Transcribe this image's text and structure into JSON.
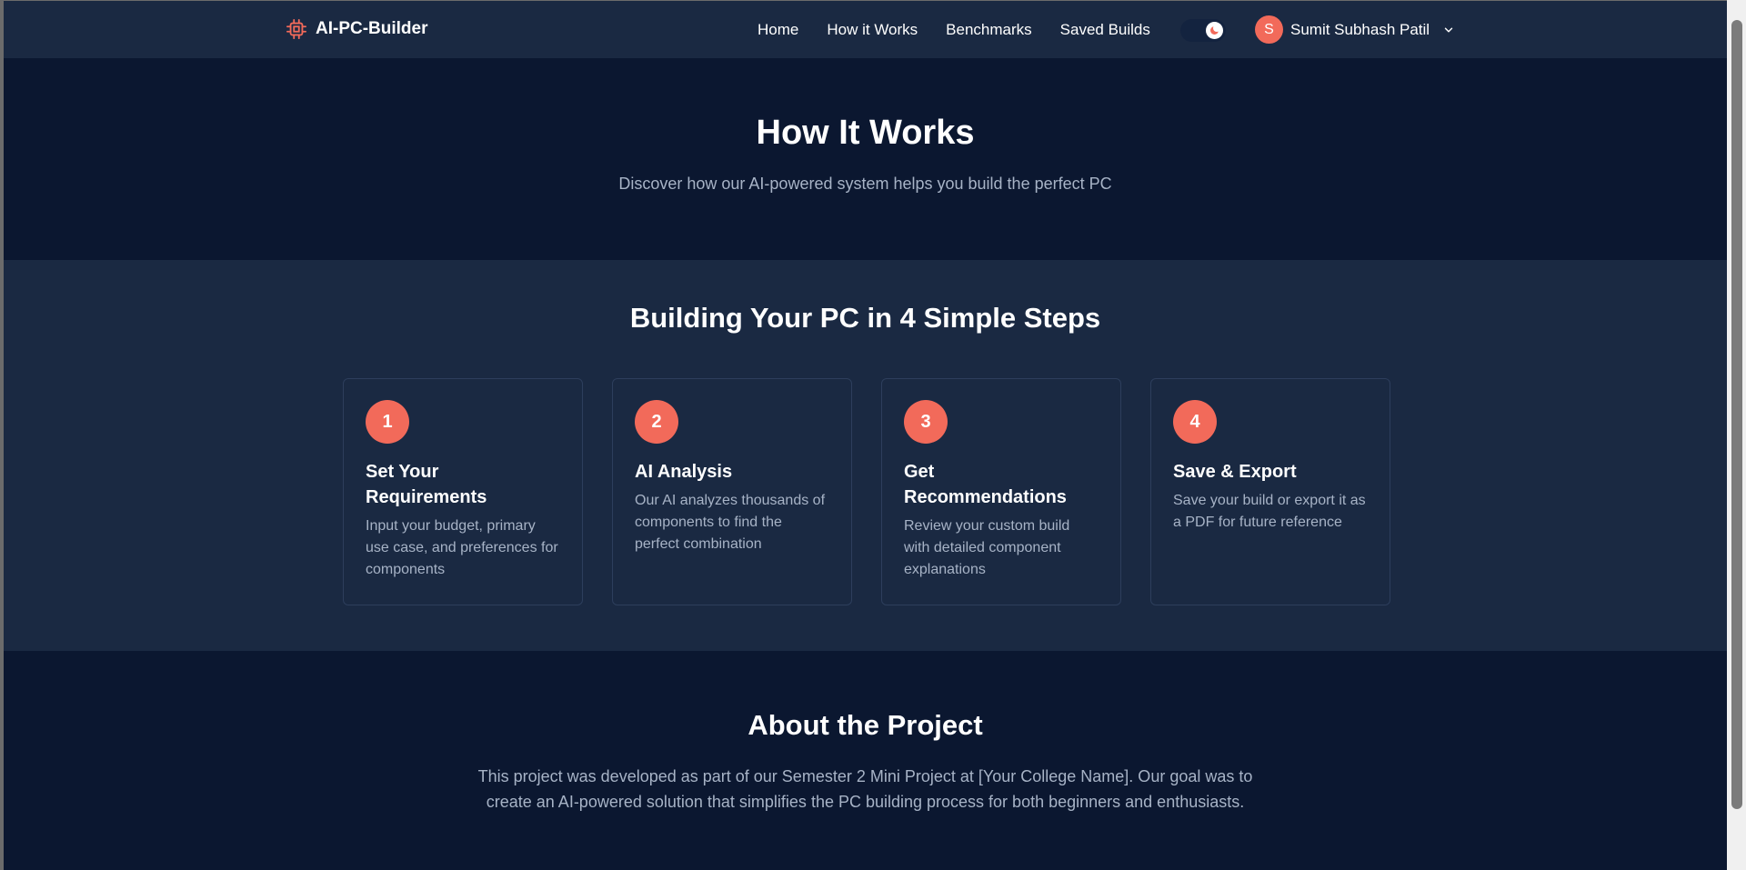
{
  "brand": {
    "name": "AI-PC-Builder",
    "icon": "chip-icon"
  },
  "nav": {
    "links": [
      "Home",
      "How it Works",
      "Benchmarks",
      "Saved Builds"
    ],
    "user": {
      "initial": "S",
      "name": "Sumit Subhash Patil"
    }
  },
  "hero": {
    "title": "How It Works",
    "subtitle": "Discover how our AI-powered system helps you build the perfect PC"
  },
  "steps": {
    "title": "Building Your PC in 4 Simple Steps",
    "items": [
      {
        "number": "1",
        "title": "Set Your Requirements",
        "description": "Input your budget, primary use case, and preferences for components"
      },
      {
        "number": "2",
        "title": "AI Analysis",
        "description": "Our AI analyzes thousands of components to find the perfect combination"
      },
      {
        "number": "3",
        "title": "Get Recommendations",
        "description": "Review your custom build with detailed component explanations"
      },
      {
        "number": "4",
        "title": "Save & Export",
        "description": "Save your build or export it as a PDF for future reference"
      }
    ]
  },
  "about": {
    "title": "About the Project",
    "text": "This project was developed as part of our Semester 2 Mini Project at [Your College Name]. Our goal was to create an AI-powered solution that simplifies the PC building process for both beginners and enthusiasts."
  },
  "colors": {
    "accent": "#f26a5a",
    "nav_bg": "#1a2942",
    "page_bg": "#0b1730",
    "muted_text": "#a7b3c6"
  }
}
